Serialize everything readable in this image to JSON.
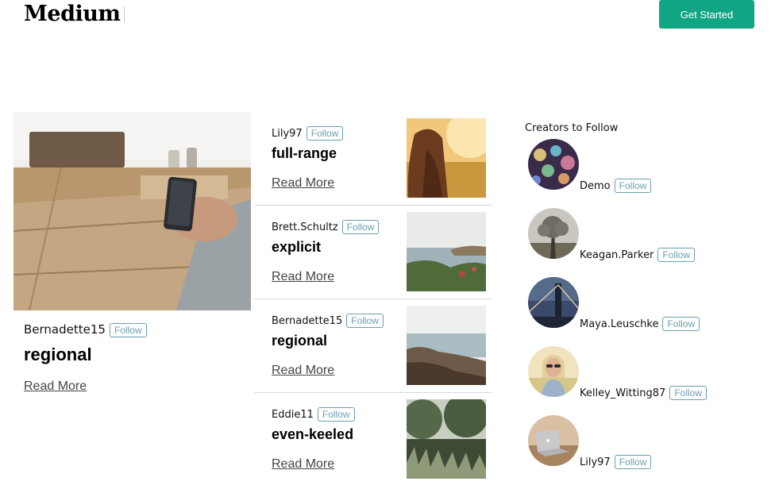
{
  "header": {
    "logo": "Medium",
    "cta_label": "Get Started",
    "accent_color": "#11a683"
  },
  "feature": {
    "author": "Bernadette15",
    "follow_label": "Follow",
    "title": "regional",
    "read_more": "Read More"
  },
  "list": [
    {
      "author": "Lily97",
      "follow_label": "Follow",
      "title": "full-range",
      "read_more": "Read More"
    },
    {
      "author": "Brett.Schultz",
      "follow_label": "Follow",
      "title": "explicit",
      "read_more": "Read More"
    },
    {
      "author": "Bernadette15",
      "follow_label": "Follow",
      "title": "regional",
      "read_more": "Read More"
    },
    {
      "author": "Eddie11",
      "follow_label": "Follow",
      "title": "even-keeled",
      "read_more": "Read More"
    }
  ],
  "creators": {
    "heading": "Creators to Follow",
    "items": [
      {
        "name": "Demo",
        "follow_label": "Follow"
      },
      {
        "name": "Keagan.Parker",
        "follow_label": "Follow"
      },
      {
        "name": "Maya.Leuschke",
        "follow_label": "Follow"
      },
      {
        "name": "Kelley_Witting87",
        "follow_label": "Follow"
      },
      {
        "name": "Lily97",
        "follow_label": "Follow"
      }
    ]
  }
}
